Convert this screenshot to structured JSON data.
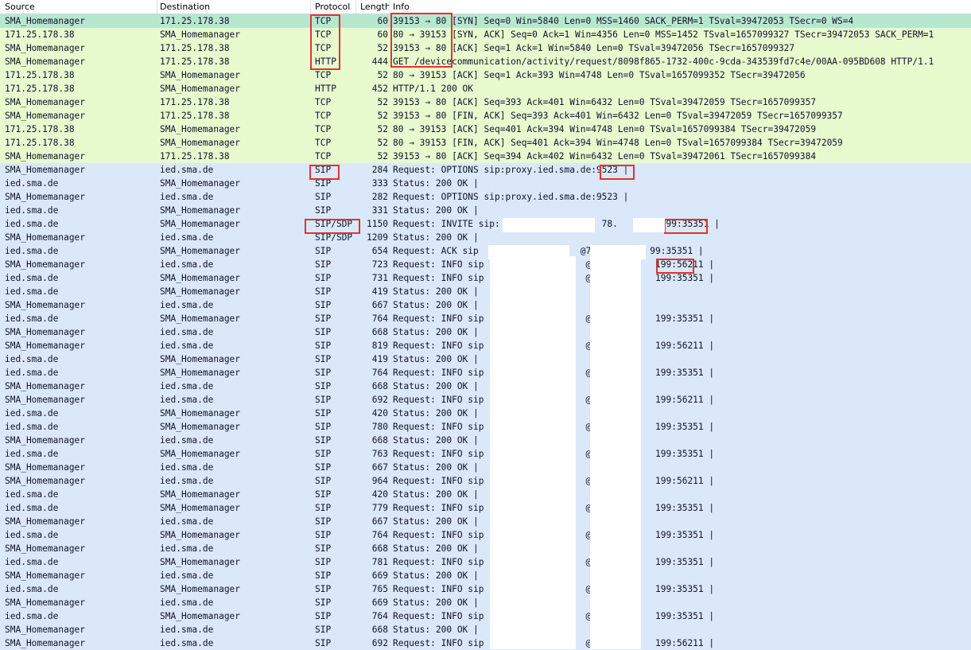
{
  "columns": {
    "source": "Source",
    "destination": "Destination",
    "protocol": "Protocol",
    "length": "Length",
    "info": "Info"
  },
  "packets": [
    {
      "src": "SMA_Homemanager",
      "dst": "171.25.178.38",
      "proto": "TCP",
      "len": "60",
      "info": "39153 → 80 [SYN] Seq=0 Win=5840 Len=0 MSS=1460 SACK_PERM=1 TSval=39472053 TSecr=0 WS=4",
      "kind": "first"
    },
    {
      "src": "171.25.178.38",
      "dst": "SMA_Homemanager",
      "proto": "TCP",
      "len": "60",
      "info": "80 → 39153 [SYN, ACK] Seq=0 Ack=1 Win=4356 Len=0 MSS=1452 TSval=1657099327 TSecr=39472053 SACK_PERM=1",
      "kind": "tcp"
    },
    {
      "src": "SMA_Homemanager",
      "dst": "171.25.178.38",
      "proto": "TCP",
      "len": "52",
      "info": "39153 → 80 [ACK] Seq=1 Ack=1 Win=5840 Len=0 TSval=39472056 TSecr=1657099327",
      "kind": "tcp"
    },
    {
      "src": "SMA_Homemanager",
      "dst": "171.25.178.38",
      "proto": "HTTP",
      "len": "444",
      "info": "GET /devicecommunication/activity/request/8098f865-1732-400c-9cda-343539fd7c4e/00AA-095BD608 HTTP/1.1",
      "kind": "tcp"
    },
    {
      "src": "171.25.178.38",
      "dst": "SMA_Homemanager",
      "proto": "TCP",
      "len": "52",
      "info": "80 → 39153 [ACK] Seq=1 Ack=393 Win=4748 Len=0 TSval=1657099352 TSecr=39472056",
      "kind": "tcp"
    },
    {
      "src": "171.25.178.38",
      "dst": "SMA_Homemanager",
      "proto": "HTTP",
      "len": "452",
      "info": "HTTP/1.1 200 OK",
      "kind": "tcp"
    },
    {
      "src": "SMA_Homemanager",
      "dst": "171.25.178.38",
      "proto": "TCP",
      "len": "52",
      "info": "39153 → 80 [ACK] Seq=393 Ack=401 Win=6432 Len=0 TSval=39472059 TSecr=1657099357",
      "kind": "tcp"
    },
    {
      "src": "SMA_Homemanager",
      "dst": "171.25.178.38",
      "proto": "TCP",
      "len": "52",
      "info": "39153 → 80 [FIN, ACK] Seq=393 Ack=401 Win=6432 Len=0 TSval=39472059 TSecr=1657099357",
      "kind": "tcp"
    },
    {
      "src": "171.25.178.38",
      "dst": "SMA_Homemanager",
      "proto": "TCP",
      "len": "52",
      "info": "80 → 39153 [ACK] Seq=401 Ack=394 Win=4748 Len=0 TSval=1657099384 TSecr=39472059",
      "kind": "tcp"
    },
    {
      "src": "171.25.178.38",
      "dst": "SMA_Homemanager",
      "proto": "TCP",
      "len": "52",
      "info": "80 → 39153 [FIN, ACK] Seq=401 Ack=394 Win=4748 Len=0 TSval=1657099384 TSecr=39472059",
      "kind": "tcp"
    },
    {
      "src": "SMA_Homemanager",
      "dst": "171.25.178.38",
      "proto": "TCP",
      "len": "52",
      "info": "39153 → 80 [ACK] Seq=394 Ack=402 Win=6432 Len=0 TSval=39472061 TSecr=1657099384",
      "kind": "tcp"
    },
    {
      "src": "SMA_Homemanager",
      "dst": "ied.sma.de",
      "proto": "SIP",
      "len": "284",
      "info": "Request: OPTIONS sip:proxy.ied.sma.de:9523 |",
      "kind": "sip"
    },
    {
      "src": "ied.sma.de",
      "dst": "SMA_Homemanager",
      "proto": "SIP",
      "len": "333",
      "info": "Status: 200 OK |",
      "kind": "sip"
    },
    {
      "src": "SMA_Homemanager",
      "dst": "ied.sma.de",
      "proto": "SIP",
      "len": "282",
      "info": "Request: OPTIONS sip:proxy.ied.sma.de:9523 |",
      "kind": "sip"
    },
    {
      "src": "ied.sma.de",
      "dst": "SMA_Homemanager",
      "proto": "SIP",
      "len": "331",
      "info": "Status: 200 OK |",
      "kind": "sip"
    },
    {
      "src": "ied.sma.de",
      "dst": "SMA_Homemanager",
      "proto": "SIP/SDP",
      "len": "1150",
      "info": "Request: INVITE sip:                   78.       .199:35351 |",
      "kind": "sip"
    },
    {
      "src": "SMA_Homemanager",
      "dst": "ied.sma.de",
      "proto": "SIP/SDP",
      "len": "1209",
      "info": "Status: 200 OK |",
      "kind": "sip"
    },
    {
      "src": "ied.sma.de",
      "dst": "SMA_Homemanager",
      "proto": "SIP",
      "len": "654",
      "info": "Request: ACK sip                   @78          99:35351 |",
      "kind": "sip"
    },
    {
      "src": "SMA_Homemanager",
      "dst": "ied.sma.de",
      "proto": "SIP",
      "len": "723",
      "info": "Request: INFO sip                   @78          199:56211 |",
      "kind": "sip"
    },
    {
      "src": "ied.sma.de",
      "dst": "SMA_Homemanager",
      "proto": "SIP",
      "len": "731",
      "info": "Request: INFO sip                   @78          199:35351 |",
      "kind": "sip"
    },
    {
      "src": "ied.sma.de",
      "dst": "SMA_Homemanager",
      "proto": "SIP",
      "len": "419",
      "info": "Status: 200 OK |",
      "kind": "sip"
    },
    {
      "src": "SMA_Homemanager",
      "dst": "ied.sma.de",
      "proto": "SIP",
      "len": "667",
      "info": "Status: 200 OK |",
      "kind": "sip"
    },
    {
      "src": "ied.sma.de",
      "dst": "SMA_Homemanager",
      "proto": "SIP",
      "len": "764",
      "info": "Request: INFO sip                   @78          199:35351 |",
      "kind": "sip"
    },
    {
      "src": "SMA_Homemanager",
      "dst": "ied.sma.de",
      "proto": "SIP",
      "len": "668",
      "info": "Status: 200 OK |",
      "kind": "sip"
    },
    {
      "src": "SMA_Homemanager",
      "dst": "ied.sma.de",
      "proto": "SIP",
      "len": "819",
      "info": "Request: INFO sip                   @78          199:56211 |",
      "kind": "sip"
    },
    {
      "src": "ied.sma.de",
      "dst": "SMA_Homemanager",
      "proto": "SIP",
      "len": "419",
      "info": "Status: 200 OK |",
      "kind": "sip"
    },
    {
      "src": "ied.sma.de",
      "dst": "SMA_Homemanager",
      "proto": "SIP",
      "len": "764",
      "info": "Request: INFO sip                   @78          199:35351 |",
      "kind": "sip"
    },
    {
      "src": "SMA_Homemanager",
      "dst": "ied.sma.de",
      "proto": "SIP",
      "len": "668",
      "info": "Status: 200 OK |",
      "kind": "sip"
    },
    {
      "src": "SMA_Homemanager",
      "dst": "ied.sma.de",
      "proto": "SIP",
      "len": "692",
      "info": "Request: INFO sip                   @78          199:56211 |",
      "kind": "sip"
    },
    {
      "src": "ied.sma.de",
      "dst": "SMA_Homemanager",
      "proto": "SIP",
      "len": "420",
      "info": "Status: 200 OK |",
      "kind": "sip"
    },
    {
      "src": "ied.sma.de",
      "dst": "SMA_Homemanager",
      "proto": "SIP",
      "len": "780",
      "info": "Request: INFO sip                   @78          199:35351 |",
      "kind": "sip"
    },
    {
      "src": "SMA_Homemanager",
      "dst": "ied.sma.de",
      "proto": "SIP",
      "len": "668",
      "info": "Status: 200 OK |",
      "kind": "sip"
    },
    {
      "src": "ied.sma.de",
      "dst": "SMA_Homemanager",
      "proto": "SIP",
      "len": "763",
      "info": "Request: INFO sip                   @78          199:35351 |",
      "kind": "sip"
    },
    {
      "src": "SMA_Homemanager",
      "dst": "ied.sma.de",
      "proto": "SIP",
      "len": "667",
      "info": "Status: 200 OK |",
      "kind": "sip"
    },
    {
      "src": "SMA_Homemanager",
      "dst": "ied.sma.de",
      "proto": "SIP",
      "len": "964",
      "info": "Request: INFO sip                   @78          199:56211 |",
      "kind": "sip"
    },
    {
      "src": "ied.sma.de",
      "dst": "SMA_Homemanager",
      "proto": "SIP",
      "len": "420",
      "info": "Status: 200 OK |",
      "kind": "sip"
    },
    {
      "src": "ied.sma.de",
      "dst": "SMA_Homemanager",
      "proto": "SIP",
      "len": "779",
      "info": "Request: INFO sip                   @78          199:35351 |",
      "kind": "sip"
    },
    {
      "src": "SMA_Homemanager",
      "dst": "ied.sma.de",
      "proto": "SIP",
      "len": "667",
      "info": "Status: 200 OK |",
      "kind": "sip"
    },
    {
      "src": "ied.sma.de",
      "dst": "SMA_Homemanager",
      "proto": "SIP",
      "len": "764",
      "info": "Request: INFO sip                   @78          199:35351 |",
      "kind": "sip"
    },
    {
      "src": "SMA_Homemanager",
      "dst": "ied.sma.de",
      "proto": "SIP",
      "len": "668",
      "info": "Status: 200 OK |",
      "kind": "sip"
    },
    {
      "src": "ied.sma.de",
      "dst": "SMA_Homemanager",
      "proto": "SIP",
      "len": "781",
      "info": "Request: INFO sip                   @78          199:35351 |",
      "kind": "sip"
    },
    {
      "src": "SMA_Homemanager",
      "dst": "ied.sma.de",
      "proto": "SIP",
      "len": "669",
      "info": "Status: 200 OK |",
      "kind": "sip"
    },
    {
      "src": "ied.sma.de",
      "dst": "SMA_Homemanager",
      "proto": "SIP",
      "len": "765",
      "info": "Request: INFO sip                   @78          199:35351 |",
      "kind": "sip"
    },
    {
      "src": "SMA_Homemanager",
      "dst": "ied.sma.de",
      "proto": "SIP",
      "len": "669",
      "info": "Status: 200 OK |",
      "kind": "sip"
    },
    {
      "src": "ied.sma.de",
      "dst": "SMA_Homemanager",
      "proto": "SIP",
      "len": "764",
      "info": "Request: INFO sip                   @78          199:35351 |",
      "kind": "sip"
    },
    {
      "src": "SMA_Homemanager",
      "dst": "ied.sma.de",
      "proto": "SIP",
      "len": "668",
      "info": "Status: 200 OK |",
      "kind": "sip"
    },
    {
      "src": "SMA_Homemanager",
      "dst": "ied.sma.de",
      "proto": "SIP",
      "len": "692",
      "info": "Request: INFO sip                   @78          199:56211 |",
      "kind": "sip"
    }
  ],
  "colors": {
    "tcp_row": "#e7fbcf",
    "first_row": "#b6e8cf",
    "sip_row": "#dae8f9",
    "highlight": "#e0342f"
  }
}
